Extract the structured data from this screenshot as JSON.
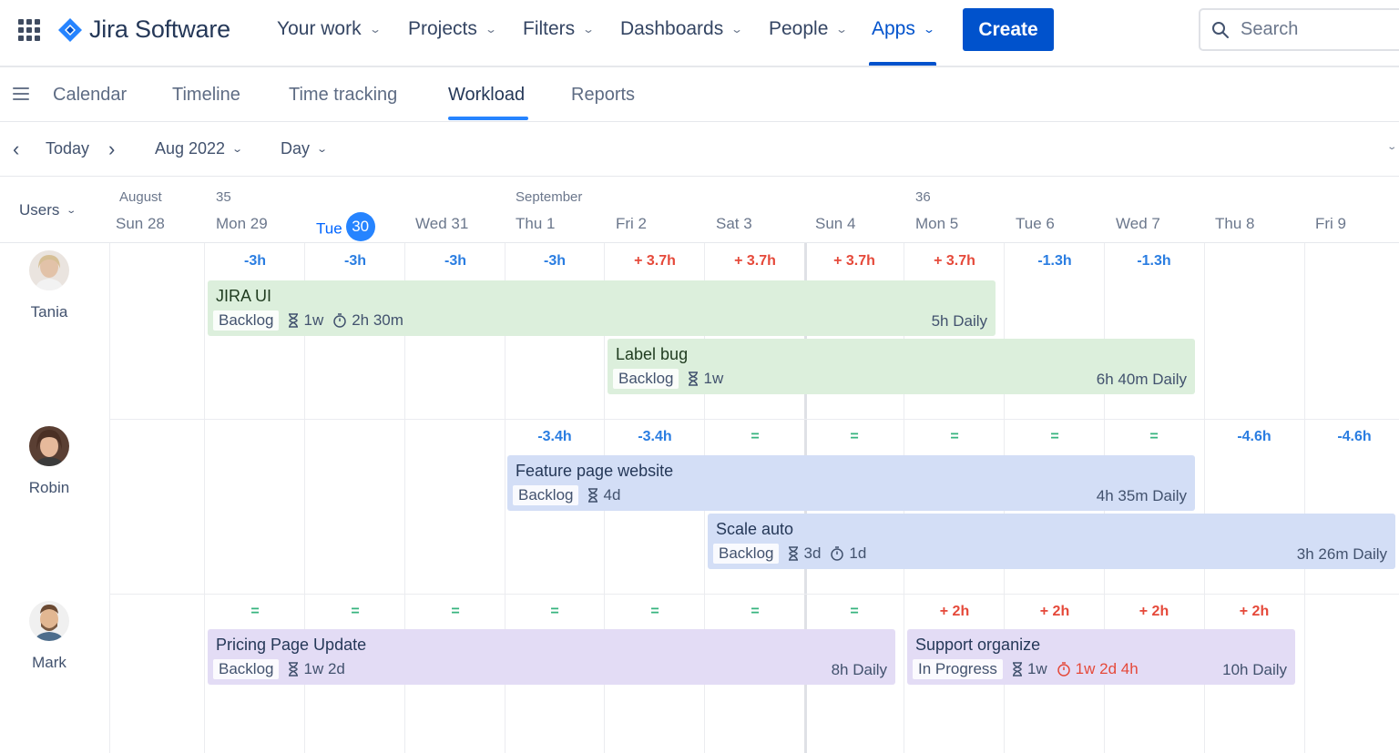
{
  "brand": {
    "name": "Jira Software",
    "color": "#2684ff"
  },
  "nav": {
    "items": [
      {
        "label": "Your work"
      },
      {
        "label": "Projects"
      },
      {
        "label": "Filters"
      },
      {
        "label": "Dashboards"
      },
      {
        "label": "People"
      },
      {
        "label": "Apps",
        "active": true
      }
    ],
    "create_label": "Create",
    "search_placeholder": "Search"
  },
  "subnav": {
    "tabs": [
      {
        "label": "Calendar"
      },
      {
        "label": "Timeline"
      },
      {
        "label": "Time tracking"
      },
      {
        "label": "Workload",
        "active": true
      },
      {
        "label": "Reports"
      }
    ]
  },
  "toolbar": {
    "today_label": "Today",
    "period_label": "Aug 2022",
    "scale_label": "Day"
  },
  "timeline": {
    "users_label": "Users",
    "months": [
      {
        "label": "August"
      },
      {
        "label": "35"
      },
      {
        "label": "September"
      },
      {
        "label": "36"
      }
    ],
    "days": [
      {
        "label": "Sun 28"
      },
      {
        "label": "Mon 29"
      },
      {
        "label": "Tue",
        "today_number": "30",
        "today": true
      },
      {
        "label": "Wed 31"
      },
      {
        "label": "Thu 1"
      },
      {
        "label": "Fri 2"
      },
      {
        "label": "Sat 3"
      },
      {
        "label": "Sun 4"
      },
      {
        "label": "Mon 5"
      },
      {
        "label": "Tue 6"
      },
      {
        "label": "Wed 7"
      },
      {
        "label": "Thu 8"
      },
      {
        "label": "Fri 9"
      }
    ]
  },
  "colors": {
    "accent": "#0052cc",
    "positive_over": "#e5493a",
    "under": "#2a7de1",
    "balanced": "#36b37e"
  },
  "users": [
    {
      "name": "Tania",
      "capacity": [
        "",
        "-3h",
        "-3h",
        "-3h",
        "-3h",
        "+ 3.7h",
        "+ 3.7h",
        "+ 3.7h",
        "+ 3.7h",
        "-1.3h",
        "-1.3h",
        "",
        ""
      ],
      "tasks": [
        {
          "title": "JIRA UI",
          "status": "Backlog",
          "estimate": "1w",
          "logged": "2h 30m",
          "rate": "5h Daily"
        },
        {
          "title": "Label bug",
          "status": "Backlog",
          "estimate": "1w",
          "rate": "6h 40m Daily"
        }
      ]
    },
    {
      "name": "Robin",
      "capacity": [
        "",
        "",
        "",
        "",
        "-3.4h",
        "-3.4h",
        "=",
        "=",
        "=",
        "=",
        "=",
        "-4.6h",
        "-4.6h"
      ],
      "tasks": [
        {
          "title": "Feature page website",
          "status": "Backlog",
          "estimate": "4d",
          "rate": "4h 35m Daily"
        },
        {
          "title": "Scale auto",
          "status": "Backlog",
          "estimate": "3d",
          "logged": "1d",
          "rate": "3h 26m Daily"
        }
      ]
    },
    {
      "name": "Mark",
      "capacity": [
        "",
        "=",
        "=",
        "=",
        "=",
        "=",
        "=",
        "=",
        "+ 2h",
        "+ 2h",
        "+ 2h",
        "+ 2h",
        ""
      ],
      "tasks": [
        {
          "title": "Pricing Page Update",
          "status": "Backlog",
          "estimate": "1w 2d",
          "rate": "8h Daily"
        },
        {
          "title": "Support organize",
          "status": "In Progress",
          "estimate": "1w",
          "logged": "1w 2d 4h",
          "logged_overdue": true,
          "rate": "10h Daily"
        }
      ]
    }
  ]
}
